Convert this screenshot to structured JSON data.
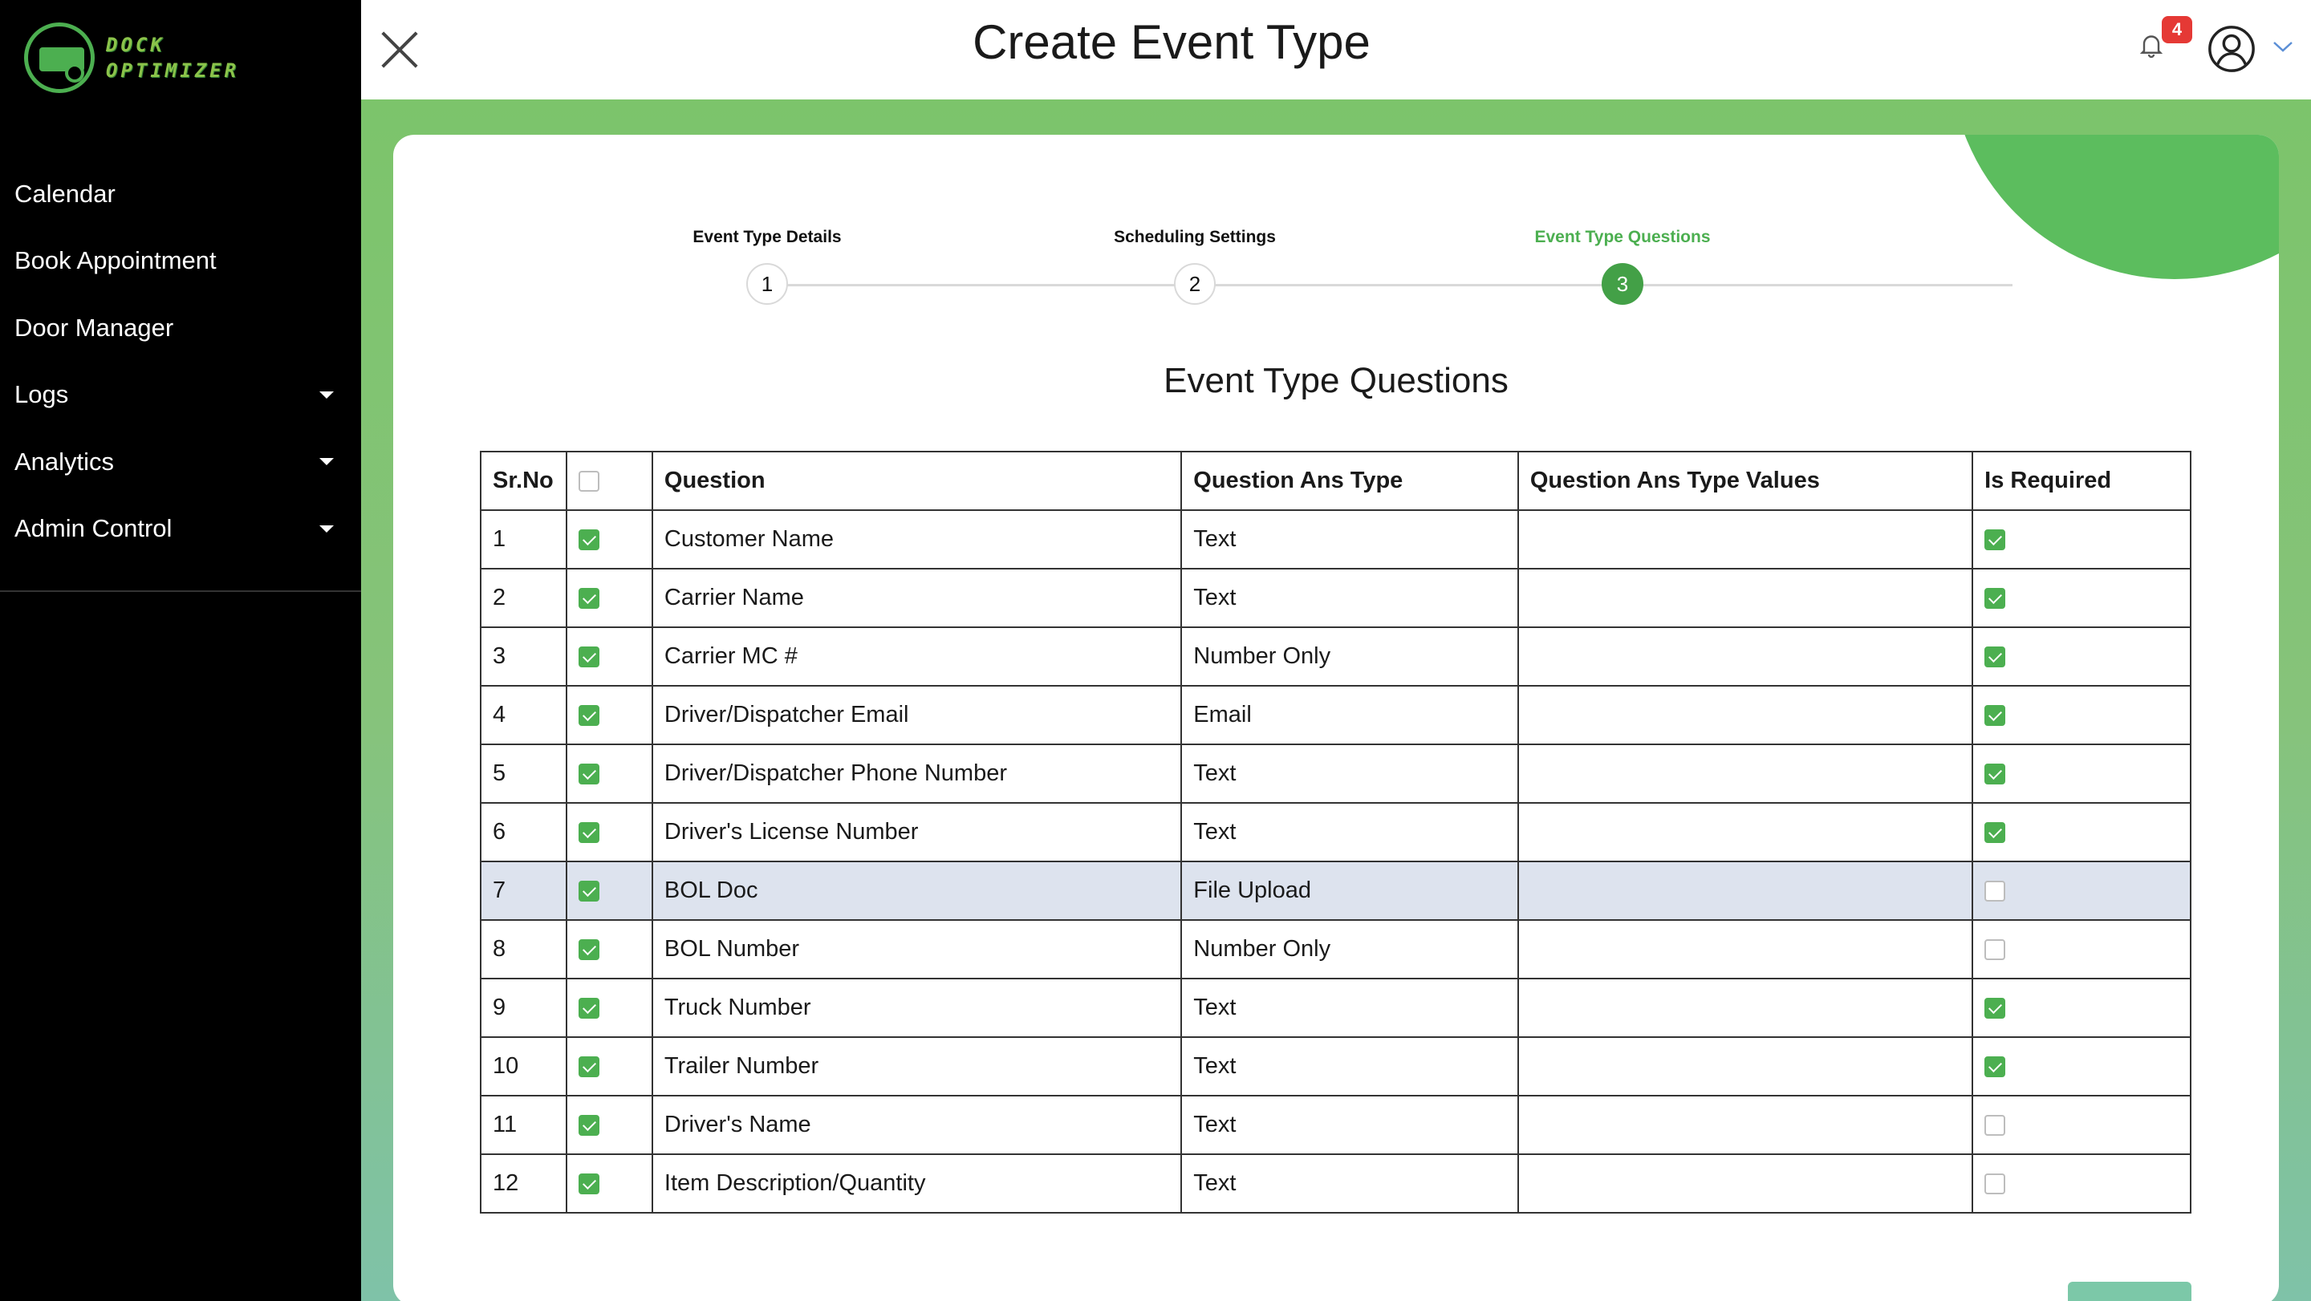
{
  "sidebar": {
    "logo_line1": "DOCK",
    "logo_line2": "OPTIMIZER",
    "items": [
      {
        "label": "Calendar"
      },
      {
        "label": "Book Appointment"
      },
      {
        "label": "Door Manager"
      },
      {
        "label": "Logs"
      },
      {
        "label": "Analytics"
      },
      {
        "label": "Admin Control"
      }
    ]
  },
  "header": {
    "title": "Create Event Type",
    "notification_count": "4"
  },
  "stepper": {
    "steps": [
      {
        "label": "Event Type Details",
        "number": "1"
      },
      {
        "label": "Scheduling Settings",
        "number": "2"
      },
      {
        "label": "Event Type Questions",
        "number": "3"
      }
    ],
    "active_step": 3
  },
  "section_title": "Event Type Questions",
  "table": {
    "headers": [
      "Sr.No",
      "",
      "Question",
      "Question Ans Type",
      "Question Ans Type Values",
      "Is Required"
    ],
    "rows": [
      {
        "sr": "1",
        "selected": true,
        "question": "Customer Name",
        "type": "Text",
        "values": "",
        "required": true
      },
      {
        "sr": "2",
        "selected": true,
        "question": "Carrier Name",
        "type": "Text",
        "values": "",
        "required": true
      },
      {
        "sr": "3",
        "selected": true,
        "question": "Carrier MC #",
        "type": "Number Only",
        "values": "",
        "required": true
      },
      {
        "sr": "4",
        "selected": true,
        "question": "Driver/Dispatcher Email",
        "type": "Email",
        "values": "",
        "required": true
      },
      {
        "sr": "5",
        "selected": true,
        "question": "Driver/Dispatcher Phone Number",
        "type": "Text",
        "values": "",
        "required": true
      },
      {
        "sr": "6",
        "selected": true,
        "question": "Driver's License Number",
        "type": "Text",
        "values": "",
        "required": true
      },
      {
        "sr": "7",
        "selected": true,
        "question": "BOL Doc",
        "type": "File Upload",
        "values": "",
        "required": false
      },
      {
        "sr": "8",
        "selected": true,
        "question": "BOL Number",
        "type": "Number Only",
        "values": "",
        "required": false
      },
      {
        "sr": "9",
        "selected": true,
        "question": "Truck Number",
        "type": "Text",
        "values": "",
        "required": true
      },
      {
        "sr": "10",
        "selected": true,
        "question": "Trailer Number",
        "type": "Text",
        "values": "",
        "required": true
      },
      {
        "sr": "11",
        "selected": true,
        "question": "Driver's Name",
        "type": "Text",
        "values": "",
        "required": false
      },
      {
        "sr": "12",
        "selected": true,
        "question": "Item Description/Quantity",
        "type": "Text",
        "values": "",
        "required": false
      }
    ],
    "highlighted_row": "7"
  },
  "colors": {
    "accent": "#4caf50",
    "sidebar_bg": "#000000",
    "badge": "#e53935"
  }
}
